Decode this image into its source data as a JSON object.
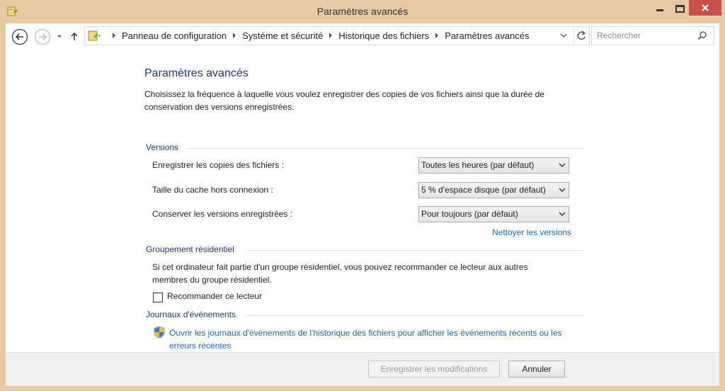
{
  "window": {
    "title": "Paramètres avancés"
  },
  "address_bar": {
    "crumbs": [
      "Panneau de configuration",
      "Système et sécurité",
      "Historique des fichiers",
      "Paramètres avancés"
    ]
  },
  "search": {
    "placeholder": "Rechercher"
  },
  "page": {
    "heading": "Paramètres avancés",
    "intro": "Choisissez la fréquence à laquelle vous voulez enregistrer des copies de vos fichiers ainsi que la durée de conservation des versions enregistrées."
  },
  "versions": {
    "title": "Versions",
    "rows": [
      {
        "label": "Enregistrer les copies des fichiers :",
        "value": "Toutes les heures (par défaut)"
      },
      {
        "label": "Taille du cache hors connexion :",
        "value": "5 % d'espace disque (par défaut)"
      },
      {
        "label": "Conserver les versions enregistrées :",
        "value": "Pour toujours (par défaut)"
      }
    ],
    "cleanup_link": "Nettoyer les versions"
  },
  "homegroup": {
    "title": "Groupement résidentiel",
    "text": "Si cet ordinateur fait partie d'un groupe résidentiel, vous pouvez recommander ce lecteur aux autres membres du groupe résidentiel.",
    "checkbox_label": "Recommander ce lecteur",
    "checked": false
  },
  "events": {
    "title": "Journaux d'événements",
    "link": "Ouvrir les journaux d'événements de l'historique des fichiers pour afficher les événements récents ou les erreurs récentes"
  },
  "footer": {
    "save_label": "Enregistrer les modifications",
    "cancel_label": "Annuler"
  },
  "colors": {
    "frame": "#e7c9a4",
    "heading_blue": "#1e3287",
    "link_blue": "#1a68c4",
    "close_red": "#c7504b"
  },
  "icons": [
    "file-history-icon",
    "minimize-icon",
    "maximize-icon",
    "close-icon",
    "back-icon",
    "forward-icon",
    "recent-dropdown-icon",
    "up-icon",
    "control-panel-icon",
    "address-dropdown-icon",
    "refresh-icon",
    "search-icon",
    "shield-icon",
    "chevron-down-icon"
  ]
}
